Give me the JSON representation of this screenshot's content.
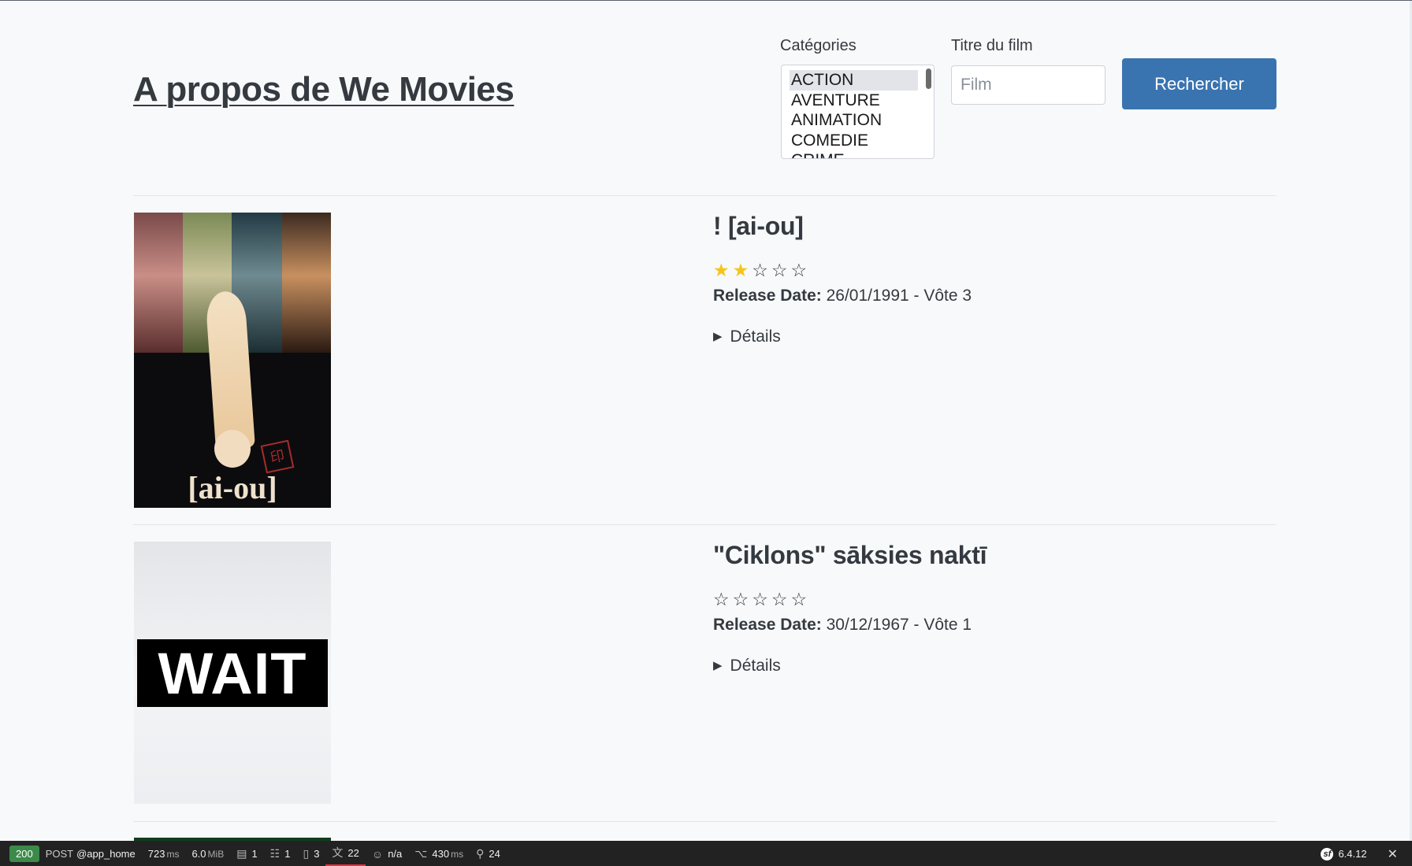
{
  "header": {
    "site_title": "A propos de We Movies",
    "categories_label": "Catégories",
    "categories": [
      "ACTION",
      "AVENTURE",
      "ANIMATION",
      "COMEDIE",
      "CRIME"
    ],
    "selected_category": "ACTION",
    "film_label": "Titre du film",
    "film_placeholder": "Film",
    "film_value": "",
    "search_button": "Rechercher"
  },
  "movies": [
    {
      "title": "! [ai-ou]",
      "rating": 2,
      "rating_max": 5,
      "release_label": "Release Date:",
      "release_value": "26/01/1991 - Vôte 3",
      "details_label": "Détails",
      "poster_caption": "[ai-ou]"
    },
    {
      "title": "\"Ciklons\" sāksies naktī",
      "rating": 0,
      "rating_max": 5,
      "release_label": "Release Date:",
      "release_value": "30/12/1967 - Vôte 1",
      "details_label": "Détails",
      "poster_caption": "WAIT"
    }
  ],
  "toolbar": {
    "status_code": "200",
    "method": "POST",
    "route": "@app_home",
    "time_value": "723",
    "time_unit": "ms",
    "memory_value": "6.0",
    "memory_unit": "MiB",
    "logs": "1",
    "forms": "1",
    "templates": "3",
    "translations": "22",
    "user": "n/a",
    "http_time_value": "430",
    "http_time_unit": "ms",
    "events": "24",
    "symfony_version": "6.4.12",
    "symfony_logo": "sf"
  },
  "colors": {
    "primary_button": "#3a74b0",
    "star_filled": "#f5c518",
    "status_ok": "#3c8a4a",
    "toolbar_bg": "#222222"
  },
  "icons": [
    "logs-icon",
    "forms-icon",
    "templates-icon",
    "translation-icon",
    "user-icon",
    "http-client-icon",
    "events-icon",
    "symfony-logo",
    "close-icon",
    "disclosure-triangle-icon",
    "star-icon"
  ]
}
